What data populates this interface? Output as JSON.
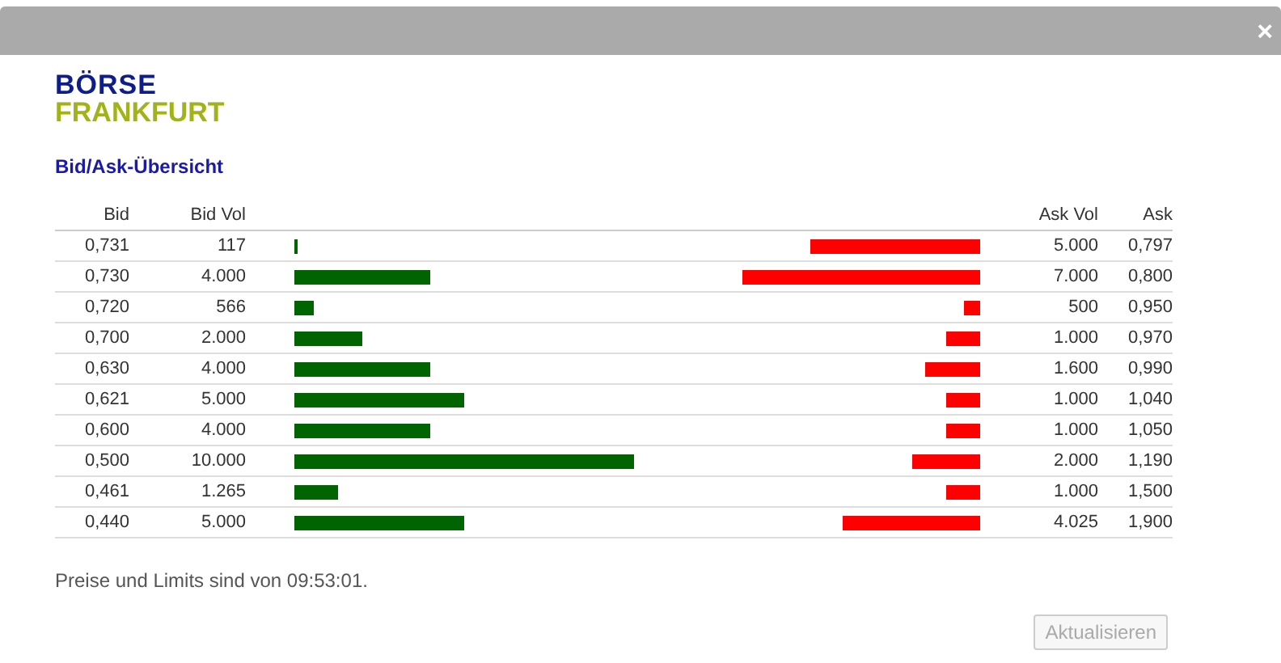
{
  "window": {
    "close": "×"
  },
  "logo": {
    "line_1": "BÖRSE",
    "line_2": "FRANKFURT"
  },
  "title": "Bid/Ask-Übersicht",
  "table": {
    "columns": [
      "Bid",
      "Bid Vol",
      "Ask Vol",
      "Ask"
    ],
    "rows": [
      {
        "bid": "0,731",
        "bid_vol": "117",
        "bid_bar": {
          "level": 0.0117
        },
        "ask_bar": {
          "level": 0.5
        },
        "ask_vol": "5.000",
        "ask": "0,797"
      },
      {
        "bid": "0,730",
        "bid_vol": "4.000",
        "bid_bar": {
          "level": 0.4
        },
        "ask_bar": {
          "level": 0.7
        },
        "ask_vol": "7.000",
        "ask": "0,800"
      },
      {
        "bid": "0,720",
        "bid_vol": "566",
        "bid_bar": {
          "level": 0.0566
        },
        "ask_bar": {
          "level": 0.05
        },
        "ask_vol": "500",
        "ask": "0,950"
      },
      {
        "bid": "0,700",
        "bid_vol": "2.000",
        "bid_bar": {
          "level": 0.2
        },
        "ask_bar": {
          "level": 0.1
        },
        "ask_vol": "1.000",
        "ask": "0,970"
      },
      {
        "bid": "0,630",
        "bid_vol": "4.000",
        "bid_bar": {
          "level": 0.4
        },
        "ask_bar": {
          "level": 0.16
        },
        "ask_vol": "1.600",
        "ask": "0,990"
      },
      {
        "bid": "0,621",
        "bid_vol": "5.000",
        "bid_bar": {
          "level": 0.5
        },
        "ask_bar": {
          "level": 0.1
        },
        "ask_vol": "1.000",
        "ask": "1,040"
      },
      {
        "bid": "0,600",
        "bid_vol": "4.000",
        "bid_bar": {
          "level": 0.4
        },
        "ask_bar": {
          "level": 0.1
        },
        "ask_vol": "1.000",
        "ask": "1,050"
      },
      {
        "bid": "0,500",
        "bid_vol": "10.000",
        "bid_bar": {
          "level": 1.0
        },
        "ask_bar": {
          "level": 0.2
        },
        "ask_vol": "2.000",
        "ask": "1,190"
      },
      {
        "bid": "0,461",
        "bid_vol": "1.265",
        "bid_bar": {
          "level": 0.1265
        },
        "ask_bar": {
          "level": 0.1
        },
        "ask_vol": "1.000",
        "ask": "1,500"
      },
      {
        "bid": "0,440",
        "bid_vol": "5.000",
        "bid_bar": {
          "level": 0.5
        },
        "ask_bar": {
          "level": 0.4025
        },
        "ask_vol": "4.025",
        "ask": "1,900"
      }
    ]
  },
  "note": "Preise und Limits sind von 09:53:01.",
  "refresh_button": {
    "label": "Aktualisieren",
    "disabled": true
  }
}
